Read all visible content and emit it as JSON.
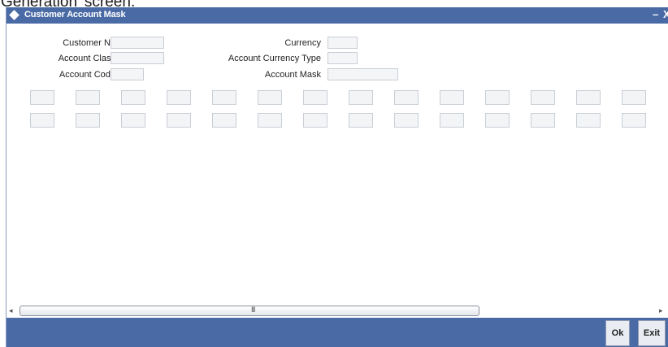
{
  "page_caption": "Generation' screen.",
  "window": {
    "title": "Customer Account Mask",
    "minimize_glyph": "–",
    "close_glyph": "X",
    "title_icon": "diamond-icon"
  },
  "form": {
    "customer_no": {
      "label": "Customer No",
      "value": ""
    },
    "account_class": {
      "label": "Account Class",
      "value": ""
    },
    "account_code": {
      "label": "Account Code",
      "value": ""
    },
    "currency": {
      "label": "Currency",
      "value": ""
    },
    "account_currency_type": {
      "label": "Account Currency Type",
      "value": ""
    },
    "account_mask": {
      "label": "Account Mask",
      "value": ""
    }
  },
  "grid": {
    "rows": 2,
    "columns": 14
  },
  "scrollbar": {
    "left_arrow": "◂",
    "right_arrow": "▸",
    "grip": "III"
  },
  "buttons": {
    "ok": "Ok",
    "exit": "Exit"
  }
}
